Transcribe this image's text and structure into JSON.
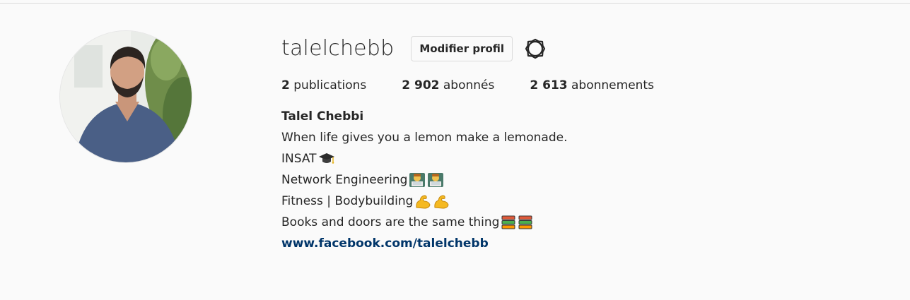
{
  "profile": {
    "username": "talelchebb",
    "edit_label": "Modifier profil",
    "settings_icon": "gear-icon"
  },
  "stats": {
    "posts_count": "2",
    "posts_label": "publications",
    "followers_count": "2 902",
    "followers_label": "abonnés",
    "following_count": "2 613",
    "following_label": "abonnements"
  },
  "bio": {
    "full_name": "Talel Chebbi",
    "lines": [
      {
        "text": "When life gives you a lemon make a lemonade.",
        "icon": ""
      },
      {
        "text": "INSAT",
        "icon": "graduation-cap-icon"
      },
      {
        "text": "Network Engineering",
        "icon": "technologist-icon"
      },
      {
        "text": "Fitness | Bodybuilding ",
        "icon": "flexed-biceps-icon"
      },
      {
        "text": "Books and doors are the same thing ",
        "icon": "books-icon"
      }
    ],
    "link": "www.facebook.com/talelchebb"
  },
  "colors": {
    "background": "#fafafa",
    "text": "#262626",
    "link": "#003569",
    "border": "#dbdbdb"
  }
}
